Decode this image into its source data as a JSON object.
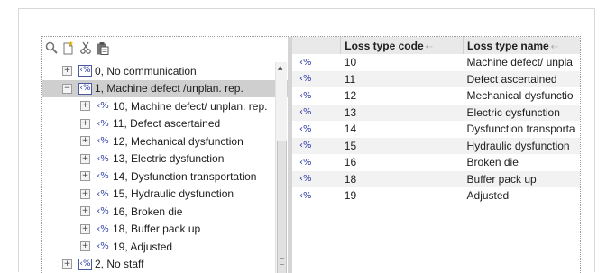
{
  "toolbar": {
    "icons": [
      "search-icon",
      "add-document-icon",
      "cut-icon",
      "paste-icon"
    ]
  },
  "tree": {
    "nodes": [
      {
        "label": "0, No communication",
        "level": 0,
        "toggle": "+",
        "selected": false
      },
      {
        "label": "1, Machine defect /unplan. rep.",
        "level": 0,
        "toggle": "−",
        "selected": true
      },
      {
        "label": "10, Machine defect/ unplan. rep.",
        "level": 1,
        "toggle": "+",
        "selected": false
      },
      {
        "label": "11, Defect ascertained",
        "level": 1,
        "toggle": "+",
        "selected": false
      },
      {
        "label": "12, Mechanical dysfunction",
        "level": 1,
        "toggle": "+",
        "selected": false
      },
      {
        "label": "13, Electric dysfunction",
        "level": 1,
        "toggle": "+",
        "selected": false
      },
      {
        "label": "14, Dysfunction transportation",
        "level": 1,
        "toggle": "+",
        "selected": false
      },
      {
        "label": "15, Hydraulic dysfunction",
        "level": 1,
        "toggle": "+",
        "selected": false
      },
      {
        "label": "16, Broken die",
        "level": 1,
        "toggle": "+",
        "selected": false
      },
      {
        "label": "18, Buffer pack up",
        "level": 1,
        "toggle": "+",
        "selected": false
      },
      {
        "label": "19, Adjusted",
        "level": 1,
        "toggle": "+",
        "selected": false
      },
      {
        "label": "2, No staff",
        "level": 0,
        "toggle": "+",
        "selected": false
      }
    ]
  },
  "grid": {
    "columns": [
      "",
      "Loss type code",
      "Loss type name"
    ],
    "rows": [
      {
        "code": "10",
        "name": "Machine defect/ unpla"
      },
      {
        "code": "11",
        "name": "Defect ascertained"
      },
      {
        "code": "12",
        "name": "Mechanical dysfunctio"
      },
      {
        "code": "13",
        "name": "Electric dysfunction"
      },
      {
        "code": "14",
        "name": "Dysfunction transporta"
      },
      {
        "code": "15",
        "name": "Hydraulic dysfunction"
      },
      {
        "code": "16",
        "name": "Broken die"
      },
      {
        "code": "18",
        "name": "Buffer pack up"
      },
      {
        "code": "19",
        "name": "Adjusted"
      }
    ]
  },
  "colors": {
    "selection": "#cfcfcf",
    "node_icon": "#2d3ea8",
    "header_bg": "#e9e9e9",
    "alt_row": "#f2f2f2"
  }
}
